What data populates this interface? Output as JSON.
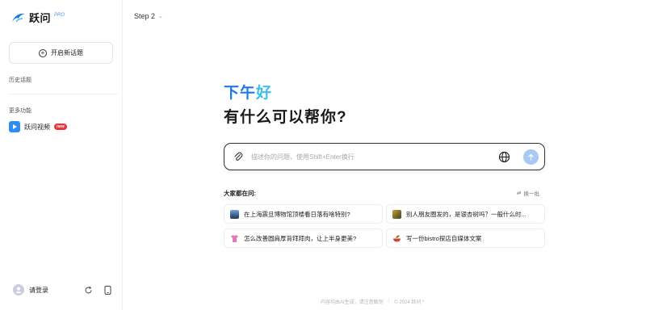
{
  "brand": {
    "name": "跃问",
    "tag": "PRO",
    "accent": "#1f78ea"
  },
  "sidebar": {
    "new_chat_label": "开启新话题",
    "history_label": "历史话题",
    "more_label": "更多功能",
    "video_item": {
      "label": "跃问视频",
      "badge": "new"
    },
    "login_label": "请登录"
  },
  "header": {
    "step_label": "Step 2"
  },
  "main": {
    "greeting_part1": "下午",
    "greeting_part2": "好",
    "headline": "有什么可以帮你?",
    "input_placeholder": "描述你的问题，使用Shift+Enter换行",
    "suggest_title": "大家都在问:",
    "refresh_label": "换一批",
    "suggestions": [
      {
        "text": "在上海震旦博物馆顶楼看日落有啥特别?",
        "icon": "building-photo-icon"
      },
      {
        "text": "别人朋友圈发的，是银杏树吗？一般什么时...",
        "icon": "tree-photo-icon"
      },
      {
        "text": "怎么改善圆肩厚背拜拜肉，让上半身更美?",
        "icon": "shirt-icon"
      },
      {
        "text": "写一份bistro探店自媒体文案",
        "icon": "food-icon"
      }
    ]
  },
  "footer": {
    "disclaimer": "内容均由AI生成，请注意甄别",
    "copyright": "© 2024 跃问 ^"
  }
}
